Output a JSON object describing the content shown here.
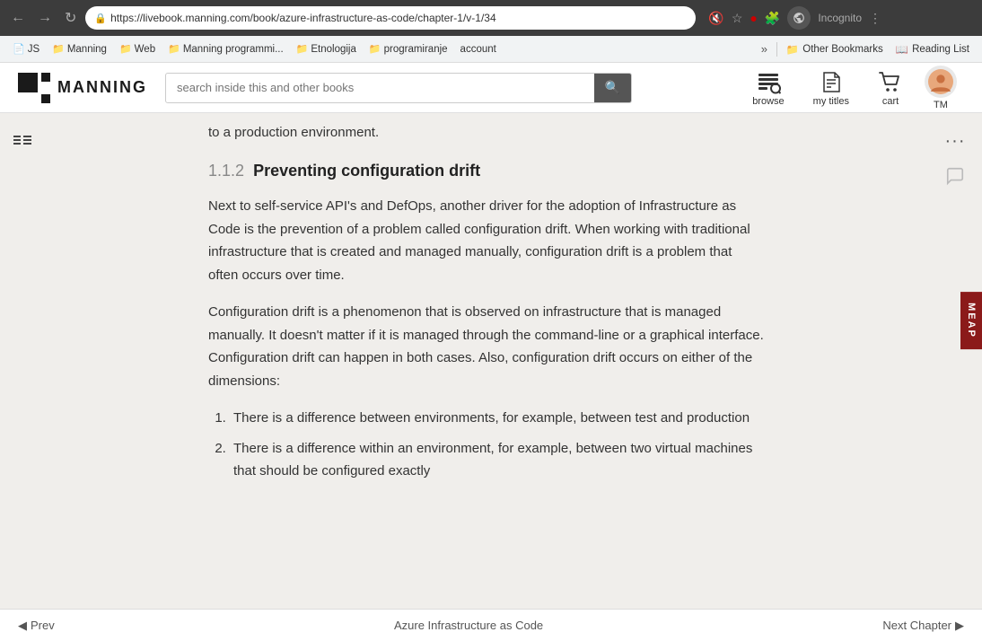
{
  "browser": {
    "url": "https://livebook.manning.com/book/azure-infrastructure-as-code/chapter-1/v-1/34",
    "profile": "Incognito"
  },
  "bookmarks": {
    "items": [
      {
        "label": "JS",
        "icon": "📄"
      },
      {
        "label": "Manning",
        "icon": "📁"
      },
      {
        "label": "Web",
        "icon": "📁"
      },
      {
        "label": "Manning programmi...",
        "icon": "📁"
      },
      {
        "label": "Etnologija",
        "icon": "📁"
      },
      {
        "label": "programiranje",
        "icon": "📁"
      },
      {
        "label": "account",
        "icon": "📄"
      }
    ],
    "more_label": "»",
    "other_bookmarks": "Other Bookmarks",
    "reading_list": "Reading List"
  },
  "manning": {
    "logo_text": "MANNING",
    "search_placeholder": "search inside this and other books",
    "nav_items": [
      {
        "label": "browse",
        "icon": "browse"
      },
      {
        "label": "my titles",
        "icon": "titles"
      },
      {
        "label": "cart",
        "icon": "cart"
      },
      {
        "label": "TM",
        "icon": "avatar"
      }
    ]
  },
  "content": {
    "intro_text": "to a production environment.",
    "section_number": "1.1.2",
    "section_title": "Preventing configuration drift",
    "paragraph1": "Next to self-service API's and DefOps, another driver for the adoption of Infrastructure as Code is the prevention of a problem called configuration drift. When working with traditional infrastructure that is created and managed manually, configuration drift is a problem that often occurs over time.",
    "paragraph2": "Configuration drift is a phenomenon that is observed on infrastructure that is managed manually. It doesn't matter if it is managed through the command-line or a graphical interface. Configuration drift can happen in both cases. Also, configuration drift occurs on either of the dimensions:",
    "list_items": [
      {
        "text": "There is a difference between environments, for example, between test and production"
      },
      {
        "text": "There is a difference within an environment, for example, between two virtual machines that should be configured exactly"
      }
    ],
    "meap_label": "MEAP"
  },
  "bottom_bar": {
    "prev_label": "◀ Prev",
    "book_title": "Azure Infrastructure as Code",
    "next_label": "Next Chapter ▶"
  }
}
